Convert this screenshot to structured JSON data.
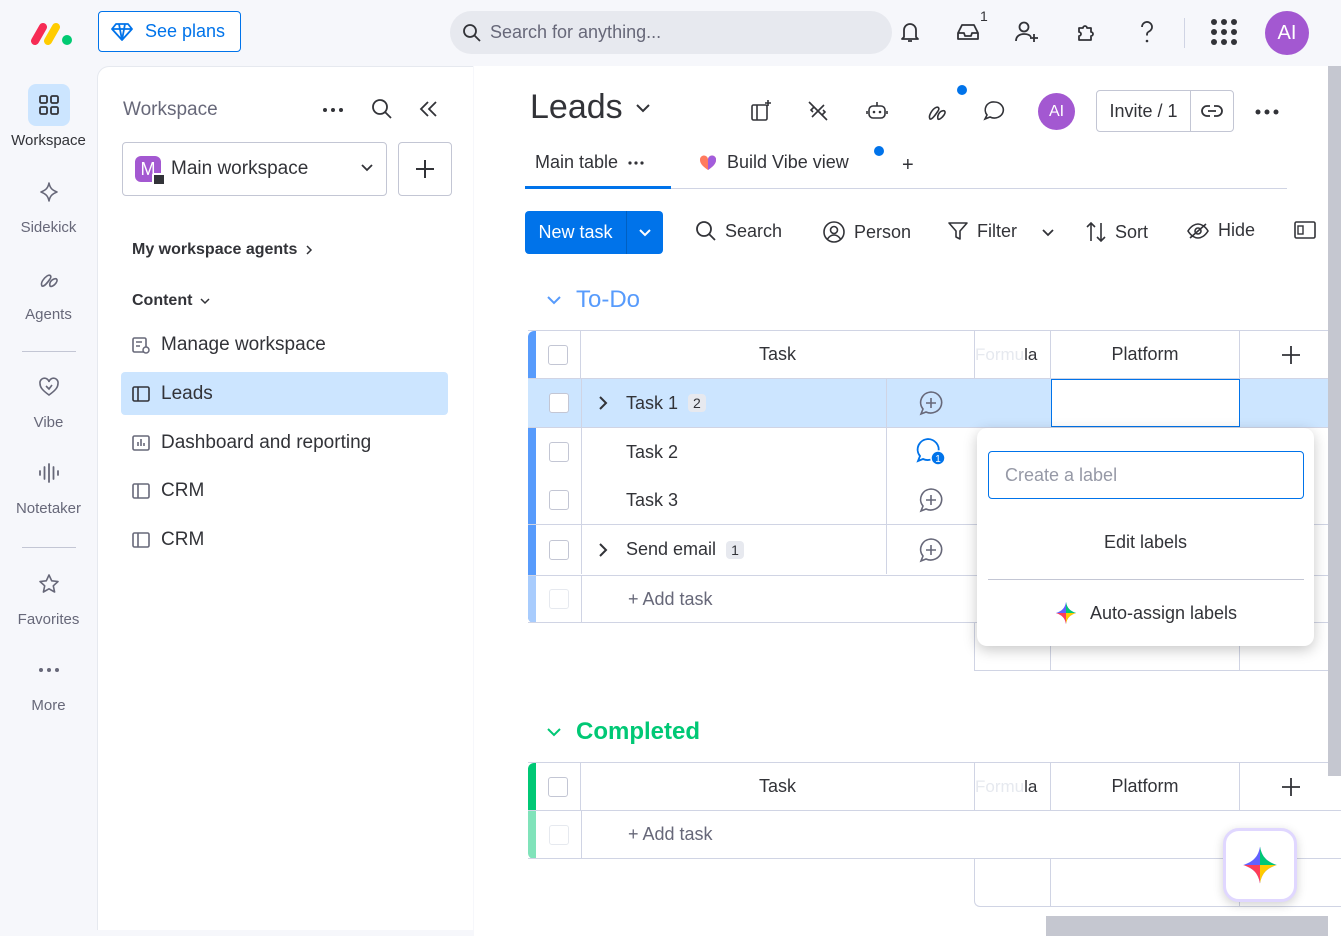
{
  "topbar": {
    "see_plans": "See plans",
    "search_placeholder": "Search for anything...",
    "inbox_count": "1",
    "user_initials": "AI"
  },
  "rail": {
    "items": [
      {
        "label": "Workspace",
        "icon": "grid-icon"
      },
      {
        "label": "Sidekick",
        "icon": "sparkle-icon"
      },
      {
        "label": "Agents",
        "icon": "agents-icon"
      },
      {
        "label": "Vibe",
        "icon": "heart-icon"
      },
      {
        "label": "Notetaker",
        "icon": "waveform-icon"
      },
      {
        "label": "Favorites",
        "icon": "star-icon"
      },
      {
        "label": "More",
        "icon": "more-dots-icon"
      }
    ]
  },
  "workspace": {
    "title": "Workspace",
    "selected": "Main workspace",
    "selected_initial": "M",
    "agents_label": "My workspace agents",
    "content_label": "Content",
    "items": [
      {
        "label": "Manage workspace",
        "icon": "manage-icon"
      },
      {
        "label": "Leads",
        "icon": "board-icon"
      },
      {
        "label": "Dashboard and reporting",
        "icon": "dashboard-icon"
      },
      {
        "label": "CRM",
        "icon": "board-icon"
      },
      {
        "label": "CRM",
        "icon": "board-icon"
      }
    ]
  },
  "board": {
    "title": "Leads",
    "user_initials": "AI",
    "invite": "Invite / 1",
    "tabs": {
      "main": "Main table",
      "vibe": "Build Vibe view",
      "add": "+"
    },
    "toolbar": {
      "new_task": "New task",
      "search": "Search",
      "person": "Person",
      "filter": "Filter",
      "sort": "Sort",
      "hide": "Hide"
    },
    "groups": [
      {
        "title": "To-Do",
        "color": "#579bfc",
        "columns": {
          "task": "Task",
          "formula_faded": "Formu",
          "formula_tail": "la",
          "platform": "Platform"
        },
        "rows": [
          {
            "name": "Task 1",
            "subitems": "2"
          },
          {
            "name": "Task 2",
            "updates": "1"
          },
          {
            "name": "Task 3"
          },
          {
            "name": "Send email",
            "subitems": "1"
          }
        ],
        "add": "+ Add task"
      },
      {
        "title": "Completed",
        "color": "#00c875",
        "columns": {
          "task": "Task",
          "formula_faded": "Formu",
          "formula_tail": "la",
          "platform": "Platform"
        },
        "add": "+ Add task"
      }
    ]
  },
  "label_popup": {
    "placeholder": "Create a label",
    "edit": "Edit labels",
    "auto": "Auto-assign labels"
  },
  "colors": {
    "primary": "#0073ea",
    "avatar": "#a358d1",
    "selected_bg": "#cce5ff"
  }
}
